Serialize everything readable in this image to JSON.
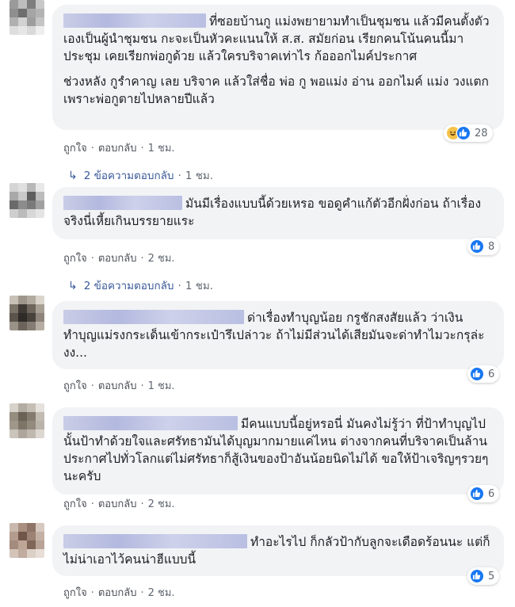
{
  "comments": [
    {
      "paragraphs": [
        "ที่ซอยบ้านกู แม่งพยายามทำเป็นชุมชน แล้วมีคนตั้งตัวเองเป็นผู้นำชุมชน กะจะเป็นหัวคะแนนให้ ส.ส. สมัยก่อน เรียกคนโน้นคนนี้มาประชุม เคยเรียกพ่อกูด้วย แล้วใครบริจาคเท่าไร ก้อออกไมค์ประกาศ",
        "ช่วงหลัง กูรำคาญ เลย บริจาค แล้วใส่ชื่อ พ่อ กู พอแม่ง อ่าน ออกไมค์ แม่ง วงแตก เพราะพ่อกูตายไปหลายปีแล้ว"
      ],
      "reaction_icons": [
        "haha-icon",
        "like-icon"
      ],
      "reaction_count": "28",
      "like_label": "ถูกใจ",
      "reply_label": "ตอบกลับ",
      "time": "1 ชม.",
      "replies_label": "2 ข้อความตอบกลับ",
      "replies_time": "1 ชม."
    },
    {
      "paragraphs": [
        "มันมีเรื่องแบบนี้ด้วยเหรอ ขอดูคำแก้ตัวอีกฝั่งก่อน ถ้าเรื่องจริงนี่เหี้ยเกินบรรยายแระ"
      ],
      "reaction_icons": [
        "like-icon"
      ],
      "reaction_count": "8",
      "like_label": "ถูกใจ",
      "reply_label": "ตอบกลับ",
      "time": "2 ชม.",
      "replies_label": "2 ข้อความตอบกลับ",
      "replies_time": "1 ชม."
    },
    {
      "paragraphs": [
        "ด่าเรื่องทำบุญน้อย กรูชักสงสัยแล้ว ว่าเงินทำบุญแม่รงกระเด็นเข้ากระเป๋ารึเปล่าวะ ถ้าไม่มีส่วนได้เสียมันจะด่าทำไมวะกรุล่ะงง..."
      ],
      "reaction_icons": [
        "like-icon"
      ],
      "reaction_count": "6",
      "like_label": "ถูกใจ",
      "reply_label": "ตอบกลับ",
      "time": "1 ชม."
    },
    {
      "paragraphs": [
        "มีคนแบบนี้อยู่หรอนี่ มันคงไม่รู้ว่า ที่ป้าทำบุญไปนั้นป้าทำด้วยใจและศรัทธามันได้บุญมากมายแค่ไหน ต่างจากคนที่บริจาคเป็นล้านประกาศไปทั่วโลกแต่ไม่ศรัทธาก็สู้เงินของป้าอันน้อยนิดไม่ได้ ขอให้ป้าเจริญๆรวยๆนะครับ"
      ],
      "reaction_icons": [
        "like-icon"
      ],
      "reaction_count": "6",
      "like_label": "ถูกใจ",
      "reply_label": "ตอบกลับ",
      "time": "2 ชม."
    },
    {
      "paragraphs": [
        "ทำอะไรไป ก็กลัวป้ากับลูกจะเดือดร้อนนะ แต่ก็ไม่น่าเอาไว้คนน่าฮีแบบนี้"
      ],
      "reaction_icons": [
        "like-icon"
      ],
      "reaction_count": "5",
      "like_label": "ถูกใจ",
      "reply_label": "ตอบกลับ",
      "time": "2 ชม."
    }
  ],
  "colors": {
    "bubble": "#f2f3f5",
    "link": "#385898",
    "meta": "#606770",
    "like": "#1877f2",
    "name_blur": "#b9bfe2"
  }
}
